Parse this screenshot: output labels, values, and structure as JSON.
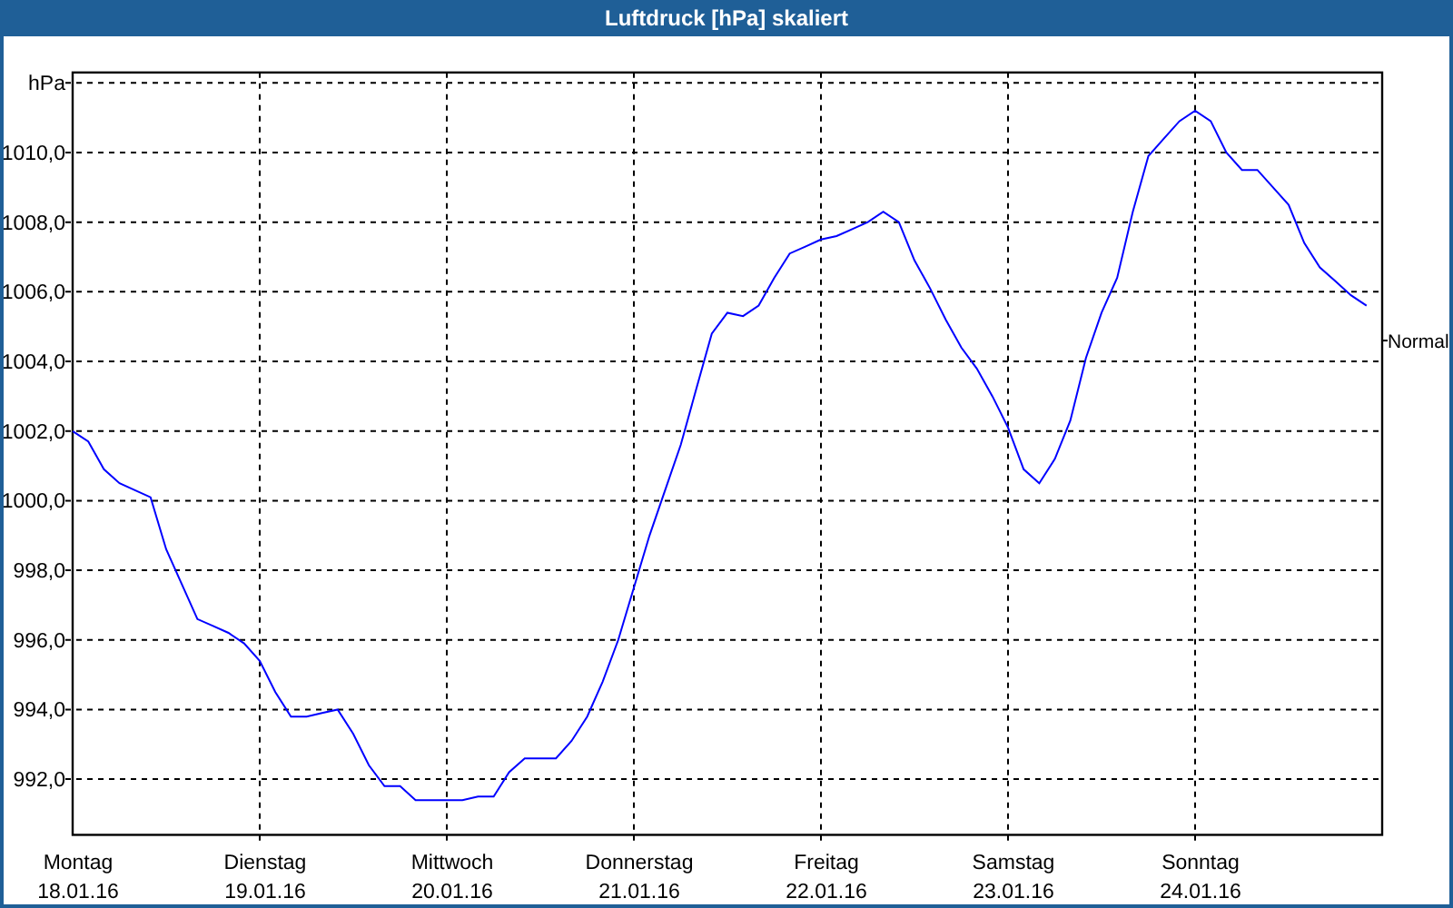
{
  "window": {
    "title": "Luftdruck [hPa] skaliert"
  },
  "chart": {
    "chart_data": {
      "type": "line",
      "grid": true,
      "ylim": [
        990.4,
        1012.3
      ],
      "categories": [
        "Montag",
        null,
        null,
        null,
        null,
        null,
        null,
        null,
        null,
        null,
        null,
        null,
        "Dienstag",
        null,
        null,
        null,
        null,
        null,
        null,
        null,
        null,
        null,
        null,
        null,
        "Mittwoch",
        null,
        null,
        null,
        null,
        null,
        null,
        null,
        null,
        null,
        null,
        null,
        "Donnerstag",
        null,
        null,
        null,
        null,
        null,
        null,
        null,
        null,
        null,
        null,
        null,
        "Freitag",
        null,
        null,
        null,
        null,
        null,
        null,
        null,
        null,
        null,
        null,
        null,
        "Samstag",
        null,
        null,
        null,
        null,
        null,
        null,
        null,
        null,
        null,
        null,
        null,
        "Sonntag",
        null,
        null,
        null,
        null,
        null,
        null,
        null,
        null,
        null,
        null,
        null
      ],
      "yticks": [
        {
          "value": 992,
          "label": "992,0"
        },
        {
          "value": 994,
          "label": "994,0"
        },
        {
          "value": 996,
          "label": "996,0"
        },
        {
          "value": 998,
          "label": "998,0"
        },
        {
          "value": 1000,
          "label": "1000,0"
        },
        {
          "value": 1002,
          "label": "1002,0"
        },
        {
          "value": 1004,
          "label": "1004,0"
        },
        {
          "value": 1006,
          "label": "1006,0"
        },
        {
          "value": 1008,
          "label": "1008,0"
        },
        {
          "value": 1010,
          "label": "1010,0"
        },
        {
          "value": 1012,
          "label": "hPa"
        }
      ],
      "series": [
        {
          "color": "#0000ff",
          "values": [
            1002.0,
            1001.7,
            1000.9,
            1000.5,
            1000.3,
            1000.1,
            998.6,
            997.6,
            996.6,
            996.4,
            996.2,
            995.9,
            995.4,
            994.5,
            993.8,
            993.8,
            993.9,
            994.0,
            993.3,
            992.4,
            991.8,
            991.8,
            991.4,
            991.4,
            991.4,
            991.4,
            991.5,
            991.5,
            992.2,
            992.6,
            992.6,
            992.6,
            993.1,
            993.8,
            994.8,
            996.0,
            997.5,
            999.0,
            1000.3,
            1001.6,
            1003.2,
            1004.8,
            1005.4,
            1005.3,
            1005.6,
            1006.4,
            1007.1,
            1007.3,
            1007.5,
            1007.6,
            1007.8,
            1008.0,
            1008.3,
            1008.0,
            1006.9,
            1006.1,
            1005.2,
            1004.4,
            1003.8,
            1003.0,
            1002.1,
            1000.9,
            1000.5,
            1001.2,
            1002.3,
            1004.1,
            1005.4,
            1006.4,
            1008.3,
            1009.9,
            1010.4,
            1010.9,
            1011.2,
            1010.9,
            1010.0,
            1009.5,
            1009.5,
            1009.0,
            1008.5,
            1007.4,
            1006.7,
            1006.3,
            1005.9,
            1005.6
          ]
        }
      ],
      "annotations": [
        "Normal"
      ]
    },
    "x_dates": [
      "18.01.16",
      "19.01.16",
      "20.01.16",
      "21.01.16",
      "22.01.16",
      "23.01.16",
      "24.01.16"
    ]
  }
}
